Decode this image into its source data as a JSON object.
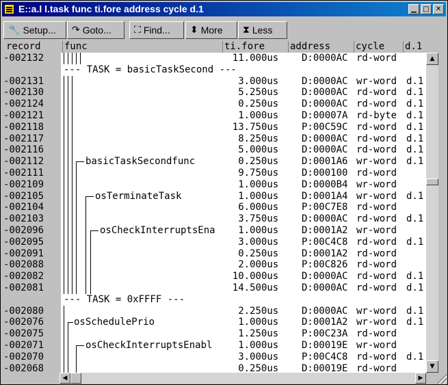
{
  "window": {
    "title": "E::a.l l.task func ti.fore address cycle d.1",
    "controls": {
      "minimize": "▁",
      "maximize": "□",
      "close": "✕"
    }
  },
  "toolbar": {
    "setup_label": "Setup...",
    "goto_label": "Goto...",
    "find_label": "Find...",
    "more_label": "More",
    "less_label": "Less"
  },
  "columns": {
    "record": "record",
    "func": "func",
    "fore": "ti.fore",
    "address": "address",
    "cycle": "cycle",
    "d1": "d.1"
  },
  "rows": [
    {
      "record": "-002132",
      "func": "",
      "fore": "11.000us",
      "address": "D:0000AC",
      "cycle": "rd-word",
      "d1": ""
    },
    {
      "task": "--- TASK = basicTaskSecond ---"
    },
    {
      "record": "-002131",
      "func": "",
      "fore": "3.000us",
      "address": "D:0000AC",
      "cycle": "wr-word",
      "d1": "d.1"
    },
    {
      "record": "-002130",
      "func": "",
      "fore": "5.250us",
      "address": "D:0000AC",
      "cycle": "rd-word",
      "d1": "d.1"
    },
    {
      "record": "-002124",
      "func": "",
      "fore": "0.250us",
      "address": "D:0000AC",
      "cycle": "rd-word",
      "d1": "d.1"
    },
    {
      "record": "-002121",
      "func": "",
      "fore": "1.000us",
      "address": "D:00007A",
      "cycle": "rd-byte",
      "d1": "d.1"
    },
    {
      "record": "-002118",
      "func": "",
      "fore": "13.750us",
      "address": "P:00C59C",
      "cycle": "rd-word",
      "d1": "d.1"
    },
    {
      "record": "-002117",
      "func": "",
      "fore": "8.250us",
      "address": "D:0000AC",
      "cycle": "rd-word",
      "d1": "d.1"
    },
    {
      "record": "-002116",
      "func": "",
      "fore": "5.000us",
      "address": "D:0000AC",
      "cycle": "rd-word",
      "d1": "d.1"
    },
    {
      "record": "-002112",
      "func": "basicTaskSecondfunc",
      "fore": "0.250us",
      "address": "D:0001A6",
      "cycle": "wr-word",
      "d1": "d.1"
    },
    {
      "record": "-002111",
      "func": "",
      "fore": "9.750us",
      "address": "D:000100",
      "cycle": "rd-word",
      "d1": ""
    },
    {
      "record": "-002109",
      "func": "",
      "fore": "1.000us",
      "address": "D:0000B4",
      "cycle": "wr-word",
      "d1": ""
    },
    {
      "record": "-002105",
      "func": "osTerminateTask",
      "fore": "1.000us",
      "address": "D:0001A4",
      "cycle": "wr-word",
      "d1": "d.1"
    },
    {
      "record": "-002104",
      "func": "",
      "fore": "6.000us",
      "address": "P:00C7E8",
      "cycle": "rd-word",
      "d1": ""
    },
    {
      "record": "-002103",
      "func": "",
      "fore": "3.750us",
      "address": "D:0000AC",
      "cycle": "rd-word",
      "d1": "d.1"
    },
    {
      "record": "-002096",
      "func": "osCheckInterruptsEna",
      "fore": "1.000us",
      "address": "D:0001A2",
      "cycle": "wr-word",
      "d1": ""
    },
    {
      "record": "-002095",
      "func": "",
      "fore": "3.000us",
      "address": "P:00C4C8",
      "cycle": "rd-word",
      "d1": "d.1"
    },
    {
      "record": "-002091",
      "func": "",
      "fore": "0.250us",
      "address": "D:0001A2",
      "cycle": "rd-word",
      "d1": ""
    },
    {
      "record": "-002088",
      "func": "",
      "fore": "2.000us",
      "address": "P:00C826",
      "cycle": "rd-word",
      "d1": ""
    },
    {
      "record": "-002082",
      "func": "",
      "fore": "10.000us",
      "address": "D:0000AC",
      "cycle": "rd-word",
      "d1": "d.1"
    },
    {
      "record": "-002081",
      "func": "",
      "fore": "14.500us",
      "address": "D:0000AC",
      "cycle": "rd-word",
      "d1": "d.1"
    },
    {
      "task": "--- TASK = 0xFFFF ---"
    },
    {
      "record": "-002080",
      "func": "",
      "fore": "2.250us",
      "address": "D:0000AC",
      "cycle": "wr-word",
      "d1": "d.1"
    },
    {
      "record": "-002076",
      "func": "osSchedulePrio",
      "fore": "1.000us",
      "address": "D:0001A2",
      "cycle": "wr-word",
      "d1": "d.1"
    },
    {
      "record": "-002075",
      "func": "",
      "fore": "1.250us",
      "address": "P:00C23A",
      "cycle": "rd-word",
      "d1": ""
    },
    {
      "record": "-002071",
      "func": "osCheckInterruptsEnabl",
      "fore": "1.000us",
      "address": "D:00019E",
      "cycle": "wr-word",
      "d1": ""
    },
    {
      "record": "-002070",
      "func": "",
      "fore": "3.000us",
      "address": "P:00C4C8",
      "cycle": "rd-word",
      "d1": "d.1"
    },
    {
      "record": "-002068",
      "func": "",
      "fore": "0.250us",
      "address": "D:00019E",
      "cycle": "rd-word",
      "d1": ""
    }
  ],
  "scrollbars": {
    "up": "▲",
    "down": "▼",
    "left": "◀",
    "right": "▶"
  }
}
